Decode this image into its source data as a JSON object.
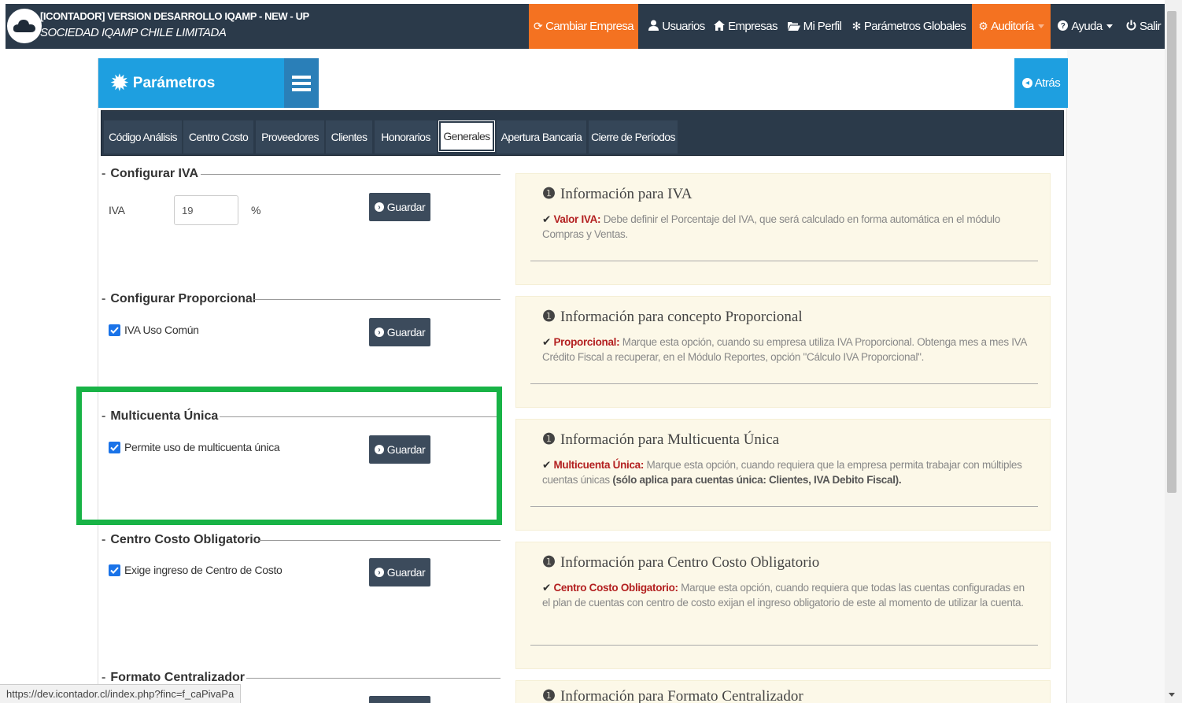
{
  "navbar": {
    "app_title": "[ICONTADOR] VERSION DESARROLLO IQAMP - NEW - UP",
    "company_name": "SOCIEDAD IQAMP CHILE LIMITADA",
    "items": [
      {
        "label": "Cambiar Empresa",
        "icon": "refresh-icon"
      },
      {
        "label": "Usuarios",
        "icon": "user-icon"
      },
      {
        "label": "Empresas",
        "icon": "home-icon"
      },
      {
        "label": "Mi Perfil",
        "icon": "folder-open-icon"
      },
      {
        "label": "Parámetros Globales",
        "icon": "gear-icon"
      },
      {
        "label": "Auditoría",
        "icon": "gears-icon"
      },
      {
        "label": "Ayuda",
        "icon": "question-circle-icon"
      },
      {
        "label": "Salir",
        "icon": "power-icon"
      }
    ],
    "accent_color": "#f47221",
    "background_color": "#2b3a4a"
  },
  "panel": {
    "title": "Parámetros",
    "back_label": "Atrás",
    "header_color": "#1e9fe0"
  },
  "tabs": [
    {
      "label": "Código Análisis",
      "active": false
    },
    {
      "label": "Centro Costo",
      "active": false
    },
    {
      "label": "Proveedores",
      "active": false
    },
    {
      "label": "Clientes",
      "active": false
    },
    {
      "label": "Honorarios",
      "active": false
    },
    {
      "label": "Generales",
      "active": true
    },
    {
      "label": "Apertura Bancaria",
      "active": false
    },
    {
      "label": "Cierre de Períodos",
      "active": false
    }
  ],
  "sections": {
    "iva": {
      "legend": "Configurar IVA",
      "field_label": "IVA",
      "value": "19",
      "unit": "%",
      "save_label": "Guardar"
    },
    "proporcional": {
      "legend": "Configurar Proporcional",
      "checkbox_label": "IVA Uso Común",
      "checked": true,
      "save_label": "Guardar"
    },
    "multicuenta": {
      "legend": "Multicuenta Única",
      "checkbox_label": "Permite uso de multicuenta única",
      "checked": true,
      "save_label": "Guardar"
    },
    "centro_costo": {
      "legend": "Centro Costo Obligatorio",
      "checkbox_label": "Exige ingreso de Centro de Costo",
      "checked": true,
      "save_label": "Guardar"
    },
    "formato": {
      "legend": "Formato Centralizador"
    }
  },
  "info": {
    "iva": {
      "title": "Información para IVA",
      "key": "Valor IVA:",
      "text": "Debe definir el Porcentaje del IVA, que será calculado en forma automática en el módulo Compras y Ventas."
    },
    "proporcional": {
      "title": "Información para concepto Proporcional",
      "key": "Proporcional:",
      "text": "Marque esta opción, cuando su empresa utiliza IVA Proporcional. Obtenga mes a mes IVA Crédito Fiscal a recuperar, en el Módulo Reportes, opción \"Cálculo IVA Proporcional\"."
    },
    "multicuenta": {
      "title": "Información para Multicuenta Única",
      "key": "Multicuenta Única:",
      "text": "Marque esta opción, cuando requiera que la empresa permita trabajar con múltiples cuentas únicas",
      "strong": "(sólo aplica para cuentas única: Clientes, IVA Debito Fiscal)."
    },
    "centro_costo": {
      "title": "Información para Centro Costo Obligatorio",
      "key": "Centro Costo Obligatorio:",
      "text": "Marque esta opción, cuando requiera que todas las cuentas configuradas en el plan de cuentas con centro de costo exijan el ingreso obligatorio de este al momento de utilizar la cuenta."
    },
    "formato": {
      "title": "Información para Formato Centralizador"
    }
  },
  "status_url": "https://dev.icontador.cl/index.php?finc=f_caPivaPa",
  "highlight_color": "#18b346"
}
